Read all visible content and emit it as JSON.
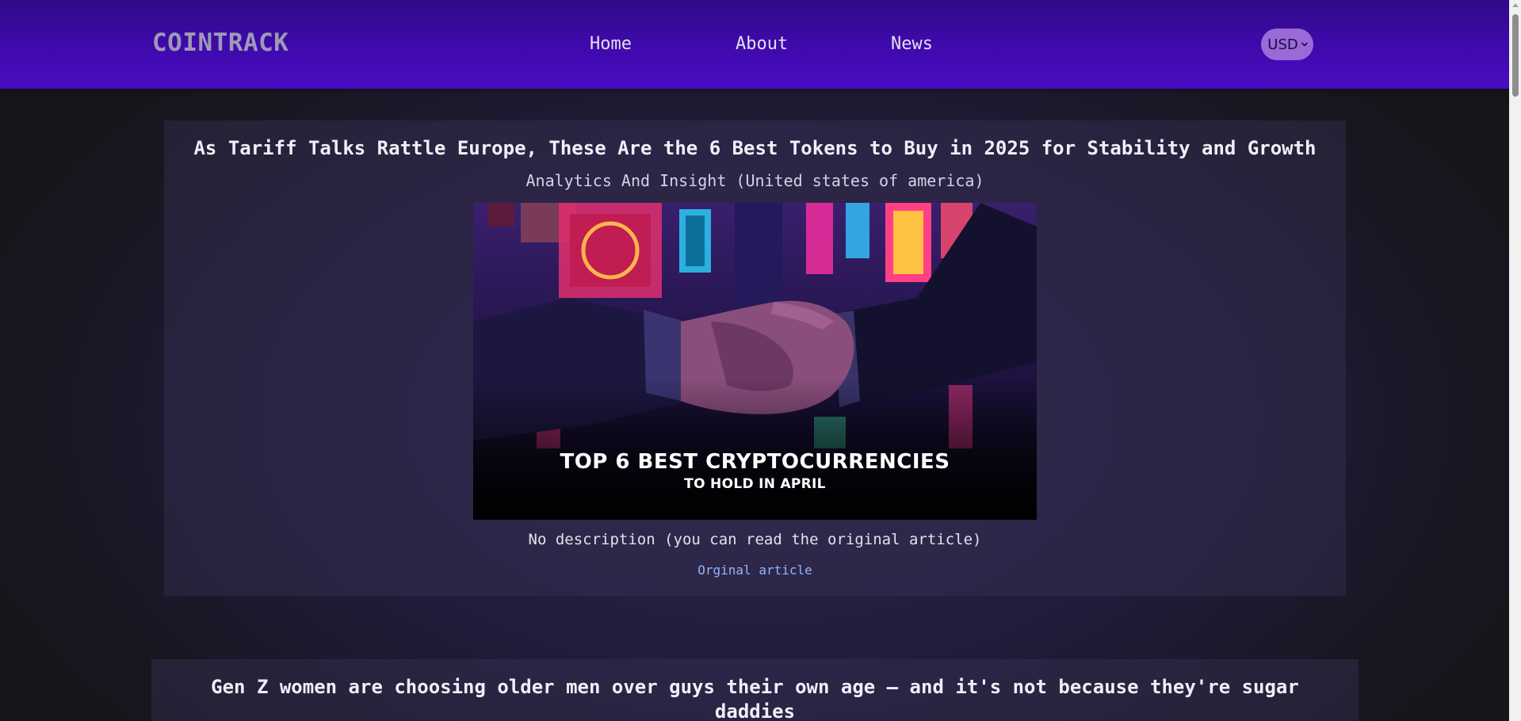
{
  "header": {
    "logo": "COINTRACK",
    "nav": {
      "home": "Home",
      "about": "About",
      "news": "News"
    },
    "currency": {
      "selected": "USD"
    }
  },
  "articles": [
    {
      "title": "As Tariff Talks Rattle Europe, These Are the 6 Best Tokens to Buy in 2025 for Stability and Growth",
      "source": "Analytics And Insight (United states of america)",
      "image": {
        "headline": "TOP 6 BEST CRYPTOCURRENCIES",
        "subheadline": "TO HOLD IN APRIL"
      },
      "description": "No description (you can read the original article)",
      "link_label": "Orginal article"
    },
    {
      "title": "Gen Z women are choosing older men over guys their own age — and it's not because they're sugar daddies"
    }
  ],
  "colors": {
    "header_start": "#2f0a86",
    "header_end": "#4a0bc2",
    "accent": "#9a6ad8",
    "link": "#8fb5ff"
  }
}
